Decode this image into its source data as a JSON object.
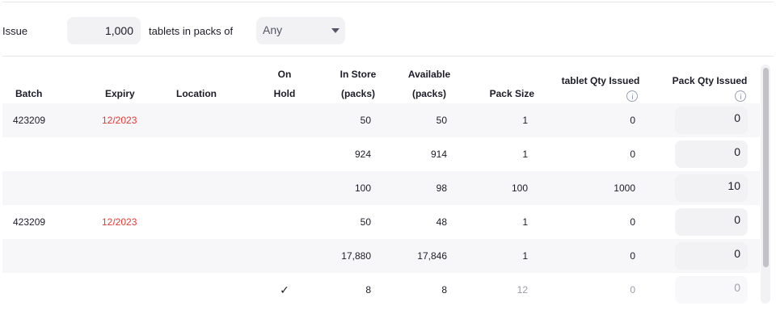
{
  "issue": {
    "label": "Issue",
    "quantity": "1,000",
    "packs_label": "tablets in packs of",
    "pack_size_selected": "Any"
  },
  "columns": {
    "batch": "Batch",
    "expiry": "Expiry",
    "location": "Location",
    "on_hold_1": "On",
    "on_hold_2": "Hold",
    "in_store_1": "In Store",
    "in_store_2": "(packs)",
    "available_1": "Available",
    "available_2": "(packs)",
    "pack_size": "Pack Size",
    "unit_qty_issued": "tablet Qty Issued",
    "pack_qty_issued": "Pack Qty Issued"
  },
  "rows": [
    {
      "batch": "423209",
      "expiry": "12/2023",
      "location": "",
      "on_hold": "",
      "in_store": "50",
      "available": "50",
      "pack_size": "1",
      "unit_qty": "0",
      "pack_qty": "0"
    },
    {
      "batch": "",
      "expiry": "",
      "location": "",
      "on_hold": "",
      "in_store": "924",
      "available": "914",
      "pack_size": "1",
      "unit_qty": "0",
      "pack_qty": "0"
    },
    {
      "batch": "",
      "expiry": "",
      "location": "",
      "on_hold": "",
      "in_store": "100",
      "available": "98",
      "pack_size": "100",
      "unit_qty": "1000",
      "pack_qty": "10"
    },
    {
      "batch": "423209",
      "expiry": "12/2023",
      "location": "",
      "on_hold": "",
      "in_store": "50",
      "available": "48",
      "pack_size": "1",
      "unit_qty": "0",
      "pack_qty": "0"
    },
    {
      "batch": "",
      "expiry": "",
      "location": "",
      "on_hold": "",
      "in_store": "17,880",
      "available": "17,846",
      "pack_size": "1",
      "unit_qty": "0",
      "pack_qty": "0"
    },
    {
      "batch": "",
      "expiry": "",
      "location": "",
      "on_hold": "✓",
      "in_store": "8",
      "available": "8",
      "pack_size": "12",
      "unit_qty": "0",
      "pack_qty": "0"
    }
  ]
}
